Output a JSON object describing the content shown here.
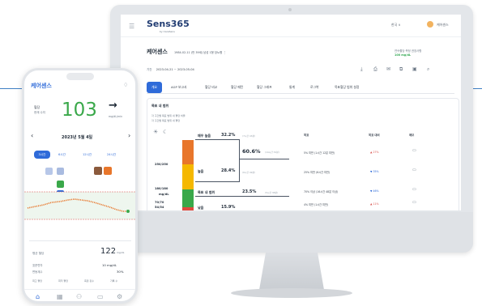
{
  "desktop": {
    "brand": {
      "name": "Sens365",
      "sub": "by CareSens"
    },
    "topbar": {
      "lang": "한국 ∨",
      "user": "케어센스"
    },
    "patient": {
      "name": "케어센스",
      "birth": "1984-02-11",
      "meta": "(만 39세)",
      "sex": "남성",
      "dtype": "1형 당뇨병",
      "alert_label": "연속혈당 측정 권장사항",
      "alert_value": "100 mg/dL"
    },
    "range": {
      "label": "기간",
      "value": "2023-04-21 ~ 2023-05-04"
    },
    "tabs": [
      "개요",
      "AGP 보고서",
      "혈당 비교",
      "혈당 패턴",
      "혈당 그래프",
      "통계",
      "로그북",
      "목표혈당 범위 설정"
    ],
    "section": {
      "title": "목표 내 범위",
      "note1": "각 구간별 목표 범위 내 혈당 비율",
      "note2": "각 구간별 목표 범위 내 혈당",
      "y_labels": [
        "250/250",
        "180/180",
        "mg/dL",
        "70/70",
        "54/54"
      ],
      "segments": [
        {
          "label": "매우 높음",
          "pct": "32.2%",
          "sub": "(7시간 43분)"
        },
        {
          "label": "높음",
          "pct": "28.4%",
          "sub": "(6시간 49분)"
        },
        {
          "label": "목표 내 범위",
          "pct": "23.5%",
          "sub": "(5시간 38분)"
        },
        {
          "label": "낮음",
          "pct": "15.9%",
          "sub": ""
        }
      ],
      "combined": {
        "pct": "60.6%",
        "sub": "(14시간 32분)"
      },
      "table_headers": [
        "목표",
        "목표 대비",
        "메모"
      ],
      "rows": [
        {
          "target": "5% 미만 (1시간 12분 미만)",
          "diff": "▲ 27%",
          "dir": "up"
        },
        {
          "target": "25% 미만 (6시간 미만)",
          "diff": "▼ 35%",
          "dir": "down"
        },
        {
          "target": "70% 이상 (16시간 48분 이상)",
          "diff": "▼ 46%",
          "dir": "down"
        },
        {
          "target": "4% 미만 (1시간 미만)",
          "diff": "▲ 11%",
          "dir": "up"
        }
      ]
    }
  },
  "phone": {
    "title": "케어센스",
    "glucose_label": "혈당",
    "glucose_unit_label": "현재 수치",
    "glucose_value": "103",
    "trend": "→",
    "trend_unit": "mg/dL/min",
    "date": "2023년 5월 4일",
    "ranges": [
      "3시간",
      "6시간",
      "12시간",
      "24시간"
    ],
    "avg_label": "평균 혈당",
    "avg_value": "122",
    "avg_unit": "mg/dL",
    "sd_label": "표준편차",
    "sd_value": "10 mg/dL",
    "cv_label": "변동계수",
    "cv_value": "30%",
    "stats": [
      "최고 혈당",
      "최저 혈당",
      "측정 횟수",
      "기록 수"
    ]
  }
}
